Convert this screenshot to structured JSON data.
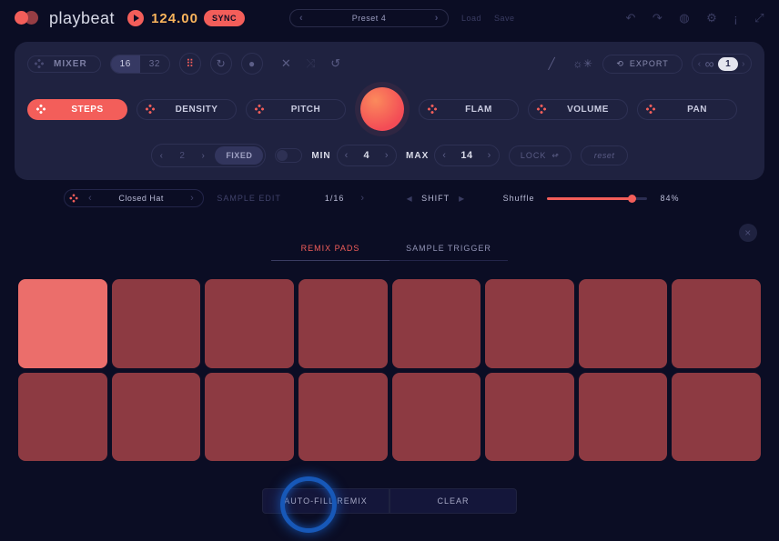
{
  "app": {
    "name": "playbeat"
  },
  "transport": {
    "bpm": "124.00",
    "sync_label": "SYNC"
  },
  "preset": {
    "name": "Preset 4",
    "load": "Load",
    "save": "Save"
  },
  "toolbar": {
    "mixer": "MIXER",
    "step16": "16",
    "step32": "32",
    "export": "EXPORT",
    "loop_count": "1"
  },
  "tabs": {
    "steps": "STEPS",
    "density": "DENSITY",
    "pitch": "PITCH",
    "flam": "FLAM",
    "volume": "VOLUME",
    "pan": "PAN"
  },
  "range": {
    "num_a": "2",
    "fixed": "FIXED",
    "min_label": "MIN",
    "min_val": "4",
    "max_label": "MAX",
    "max_val": "14",
    "lock": "LOCK",
    "reset": "reset"
  },
  "strip": {
    "sample_name": "Closed Hat",
    "sample_edit": "SAMPLE EDIT",
    "grid": "1/16",
    "shift": "SHIFT",
    "shuffle_label": "Shuffle",
    "shuffle_pct": "84%"
  },
  "mode": {
    "remix": "REMIX PADS",
    "trigger": "SAMPLE TRIGGER"
  },
  "pads": {
    "count": 16,
    "active": 0
  },
  "bottom": {
    "autofill": "AUTO-FILL REMIX",
    "clear": "CLEAR"
  }
}
